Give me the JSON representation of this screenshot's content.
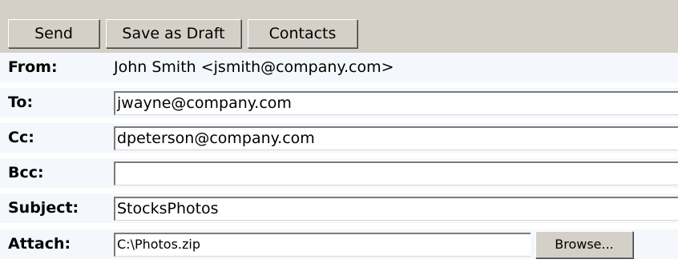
{
  "toolbar": {
    "send_label": "Send",
    "save_draft_label": "Save as Draft",
    "contacts_label": "Contacts"
  },
  "form": {
    "from": {
      "label": "From:",
      "value": "John Smith <jsmith@company.com>"
    },
    "to": {
      "label": "To:",
      "value": "jwayne@company.com"
    },
    "cc": {
      "label": "Cc:",
      "value": "dpeterson@company.com"
    },
    "bcc": {
      "label": "Bcc:",
      "value": ""
    },
    "subject": {
      "label": "Subject:",
      "value": "StocksPhotos"
    },
    "attach": {
      "label": "Attach:",
      "value": "C:\\Photos.zip",
      "browse_label": "Browse..."
    }
  },
  "colors": {
    "toolbar_bg": "#d4d0c8",
    "form_row_bg": "#f4f8fc",
    "field_bg": "#ffffff"
  }
}
